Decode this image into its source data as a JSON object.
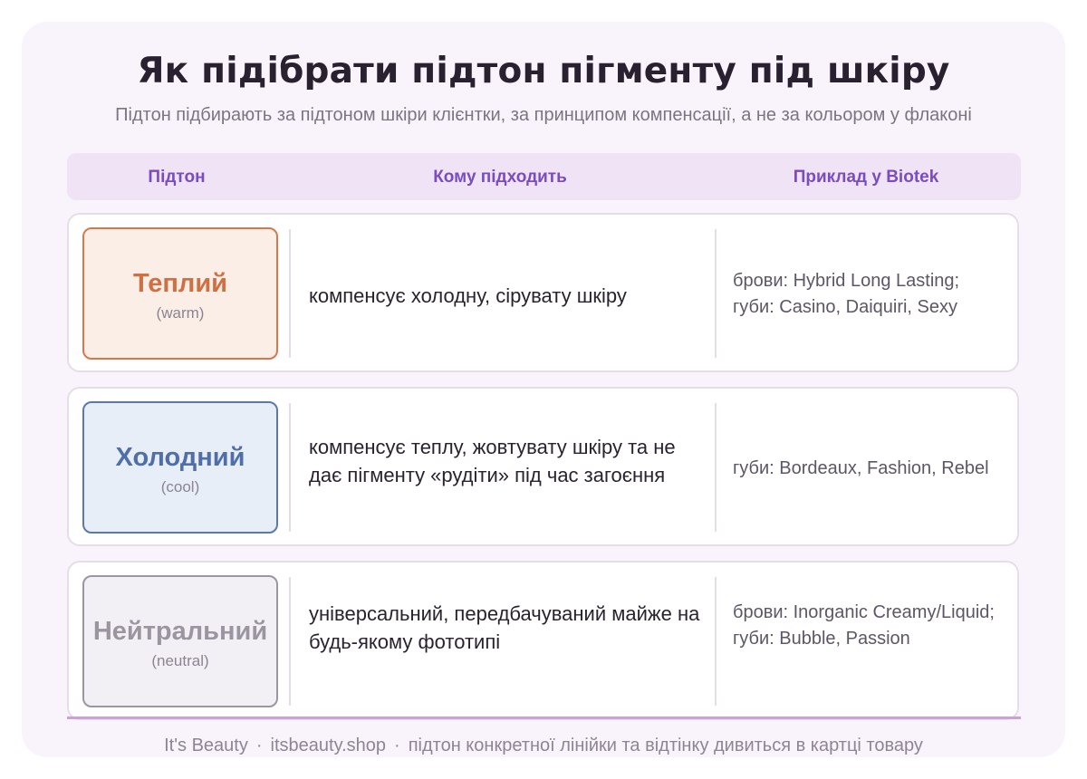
{
  "title": "Як підібрати підтон пігменту під шкіру",
  "subtitle": "Підтон підбирають за підтоном шкіри клієнтки, за принципом компенсації, а не за кольором у флаконі",
  "table": {
    "headers": [
      "Підтон",
      "Кому підходить",
      "Приклад у Biotek"
    ],
    "rows": [
      {
        "tone": "Теплий",
        "tone_en": "(warm)",
        "fit": "компенсує холодну, сірувату шкіру",
        "example": "брови: Hybrid Long Lasting; губи: Casino, Daiquiri, Sexy",
        "color": "#d6784c"
      },
      {
        "tone": "Холодний",
        "tone_en": "(cool)",
        "fit": "компенсує теплу, жовтувату шкіру та не дає пігменту «рудіти» під час загоєння",
        "example": "губи: Bordeaux, Fashion, Rebel",
        "color": "#5c79ad"
      },
      {
        "tone": "Нейтральний",
        "tone_en": "(neutral)",
        "fit": "універсальний, передбачуваний майже на будь-якому фототипі",
        "example": "брови: Inorganic Creamy/Liquid; губи: Bubble, Passion",
        "color": "#9b96a0"
      }
    ]
  },
  "footer": {
    "brand": "It's Beauty",
    "sep": "·",
    "site": "itsbeauty.shop",
    "note": "підтон конкретної лінійки та відтінку дивиться в картці товару"
  },
  "colors": {
    "accent": "#7a4cc0",
    "header_bg": "#efe3f5",
    "card_bg": "#f9f4fb"
  }
}
